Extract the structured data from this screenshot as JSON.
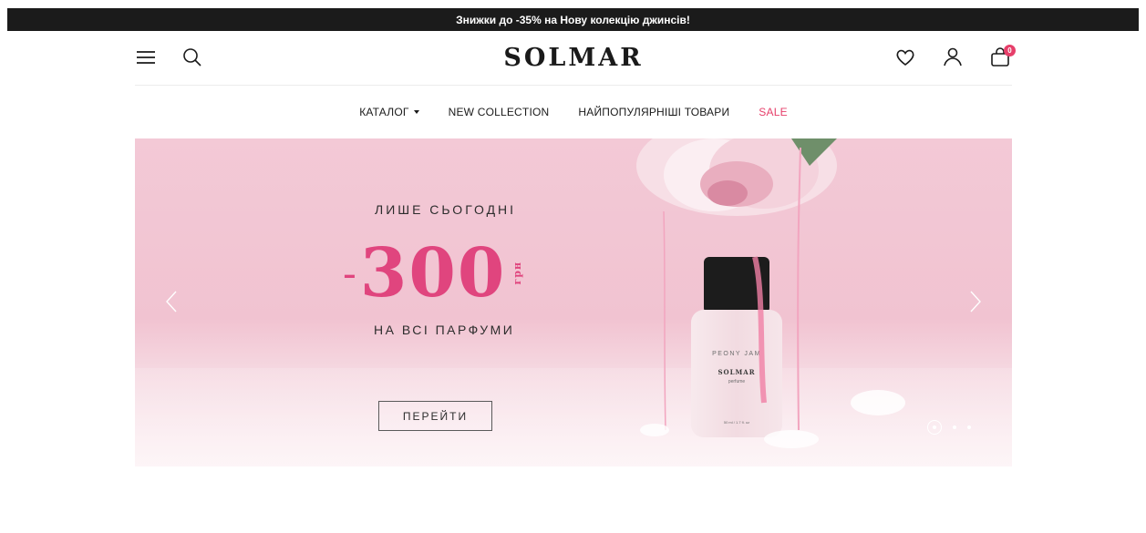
{
  "promo": {
    "text": "Знижки до -35% на Нову колекцію джинсів!"
  },
  "header": {
    "logo": "SOLMAR",
    "cart_count": "0",
    "icons": {
      "menu": "hamburger-icon",
      "search": "search-icon",
      "wishlist": "heart-icon",
      "account": "user-icon",
      "cart": "shopping-bag-icon"
    }
  },
  "nav": {
    "items": [
      {
        "label": "КАТАЛОГ"
      },
      {
        "label": "NEW COLLECTION"
      },
      {
        "label": "НАЙПОПУЛЯРНІШІ ТОВАРИ"
      },
      {
        "label": "SALE"
      }
    ]
  },
  "hero": {
    "eyebrow": "ЛИШЕ СЬОГОДНІ",
    "minus": "-",
    "amount": "300",
    "unit": "грн",
    "subtitle": "НА ВСІ ПАРФУМИ",
    "cta": "ПЕРЕЙТИ",
    "bottle_label": "PEONY JAM",
    "bottle_brand": "SOLMAR",
    "bottle_type": "perfume",
    "bottle_volume": "50 ml / 1.7 fl. oz",
    "slides_total": 3,
    "active_slide": 1
  },
  "colors": {
    "accent": "#e0457e",
    "sale": "#e63f6a",
    "promo_bg": "#1b1b1b"
  }
}
